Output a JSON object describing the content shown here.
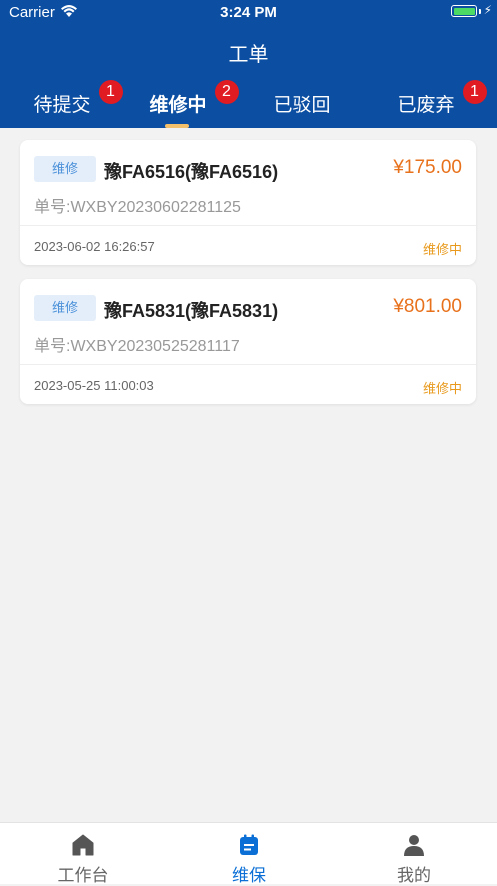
{
  "status_bar": {
    "carrier": "Carrier",
    "time": "3:24 PM"
  },
  "header": {
    "title": "工单"
  },
  "tabs": [
    {
      "label": "待提交",
      "badge": "1"
    },
    {
      "label": "维修中",
      "badge": "2"
    },
    {
      "label": "已驳回",
      "badge": ""
    },
    {
      "label": "已废弃",
      "badge": "1"
    }
  ],
  "active_tab": "维修中",
  "orders": [
    {
      "tag": "维修",
      "plate": "豫FA6516(豫FA6516)",
      "price": "¥175.00",
      "order_no": "单号:WXBY20230602281125",
      "date": "2023-06-02 16:26:57",
      "status": "维修中"
    },
    {
      "tag": "维修",
      "plate": "豫FA5831(豫FA5831)",
      "price": "¥801.00",
      "order_no": "单号:WXBY20230525281117",
      "date": "2023-05-25 11:00:03",
      "status": "维修中"
    }
  ],
  "tabbar": [
    {
      "label": "工作台",
      "icon": "home-icon"
    },
    {
      "label": "维保",
      "icon": "calendar-icon"
    },
    {
      "label": "我的",
      "icon": "user-icon"
    }
  ],
  "colors": {
    "header": "#0b4ea2",
    "badge": "#e11b22",
    "price": "#e8711c",
    "status": "#e8991c",
    "tabbar_active": "#0b6fd6"
  }
}
